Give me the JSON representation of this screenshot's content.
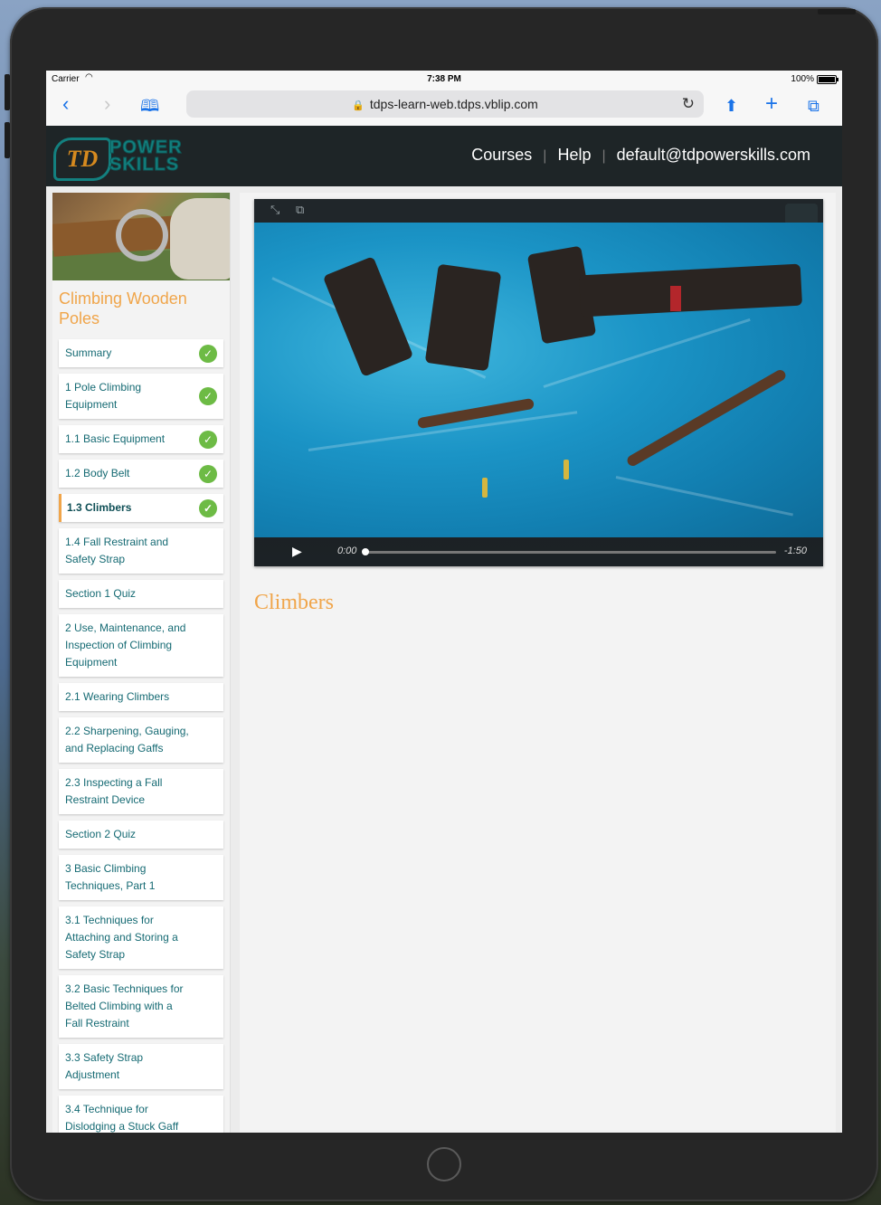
{
  "status_bar": {
    "carrier": "Carrier",
    "time": "7:38 PM",
    "battery": "100%"
  },
  "browser": {
    "url": "tdps-learn-web.tdps.vblip.com"
  },
  "site": {
    "logo_line1": "POWER",
    "logo_line2": "SKILLS",
    "logo_mark": "TD",
    "nav": [
      "Courses",
      "Help",
      "default@tdpowerskills.com"
    ]
  },
  "course": {
    "title": "Climbing Wooden Poles",
    "lessons": [
      {
        "label": "Summary",
        "completed": true,
        "active": false
      },
      {
        "label": "1 Pole Climbing Equipment",
        "completed": true,
        "active": false
      },
      {
        "label": "1.1 Basic Equipment",
        "completed": true,
        "active": false
      },
      {
        "label": "1.2 Body Belt",
        "completed": true,
        "active": false
      },
      {
        "label": "1.3 Climbers",
        "completed": true,
        "active": true
      },
      {
        "label": "1.4 Fall Restraint and Safety Strap",
        "completed": false,
        "active": false
      },
      {
        "label": "Section 1 Quiz",
        "completed": false,
        "active": false
      },
      {
        "label": "2 Use, Maintenance, and Inspection of Climbing Equipment",
        "completed": false,
        "active": false
      },
      {
        "label": "2.1 Wearing Climbers",
        "completed": false,
        "active": false
      },
      {
        "label": "2.2 Sharpening, Gauging, and Replacing Gaffs",
        "completed": false,
        "active": false
      },
      {
        "label": "2.3 Inspecting a Fall Restraint Device",
        "completed": false,
        "active": false
      },
      {
        "label": "Section 2 Quiz",
        "completed": false,
        "active": false
      },
      {
        "label": "3 Basic Climbing Techniques, Part 1",
        "completed": false,
        "active": false
      },
      {
        "label": "3.1 Techniques for Attaching and Storing a Safety Strap",
        "completed": false,
        "active": false
      },
      {
        "label": "3.2 Basic Techniques for Belted Climbing with a Fall Restraint",
        "completed": false,
        "active": false
      },
      {
        "label": "3.3 Safety Strap Adjustment",
        "completed": false,
        "active": false
      },
      {
        "label": "3.4 Technique for Dislodging a Stuck Gaff",
        "completed": false,
        "active": false
      }
    ]
  },
  "video": {
    "current_time": "0:00",
    "remaining_time": "-1:50",
    "progress": 0
  },
  "lesson_title": "Climbers",
  "colors": {
    "accent": "#f0a54a",
    "link": "#156a73",
    "check": "#6dbb45",
    "header_bg": "#1e2527"
  }
}
